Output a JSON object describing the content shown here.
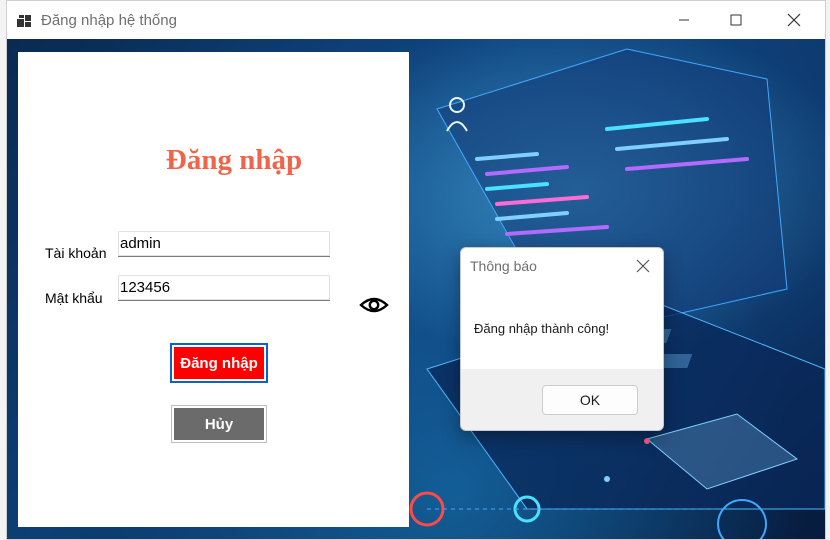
{
  "window": {
    "title": "Đăng nhập hệ thống",
    "icons": [
      "app-icon",
      "minimize-icon",
      "maximize-icon",
      "close-icon"
    ]
  },
  "login": {
    "heading": "Đăng nhập",
    "username_label": "Tài khoản",
    "username_value": "admin",
    "password_label": "Mật khẩu",
    "password_value": "123456",
    "show_password_icon": "eye-icon",
    "login_button": "Đăng nhập",
    "cancel_button": "Hủy",
    "colors": {
      "heading": "#f06449",
      "login_button_bg": "#ff0000",
      "cancel_button_bg": "#6b6b6b"
    }
  },
  "dialog": {
    "title": "Thông báo",
    "message": "Đăng nhập thành công!",
    "ok_button": "OK"
  }
}
